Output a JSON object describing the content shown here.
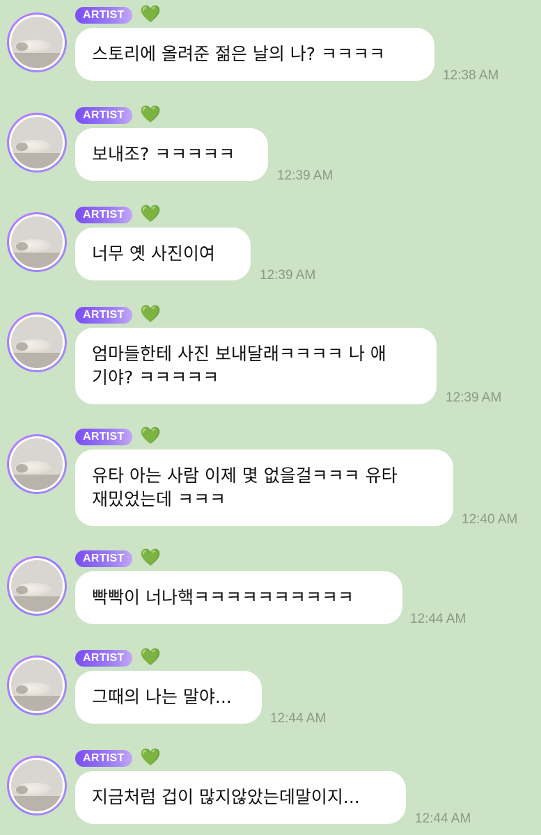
{
  "badge_label": "ARTIST",
  "heart_icon": "💚",
  "messages": [
    {
      "text": "스토리에 올려준 젊은 날의 나? ㅋㅋㅋㅋ",
      "time": "12:38 AM"
    },
    {
      "text": "보내조? ㅋㅋㅋㅋㅋ",
      "time": "12:39 AM"
    },
    {
      "text": "너무 옛 사진이여",
      "time": "12:39 AM"
    },
    {
      "text": "엄마들한테 사진 보내달래ㅋㅋㅋㅋ 나 애\n기야? ㅋㅋㅋㅋㅋ",
      "time": "12:39 AM"
    },
    {
      "text": "유타 아는 사람 이제 몇 없을걸ㅋㅋㅋ 유타\n재밌었는데 ㅋㅋㅋ",
      "time": "12:40 AM"
    },
    {
      "text": "빡빡이 너나핵ㅋㅋㅋㅋㅋㅋㅋㅋㅋㅋ",
      "time": "12:44 AM"
    },
    {
      "text": "그때의 나는 말야...",
      "time": "12:44 AM"
    },
    {
      "text": "지금처럼 겁이 많지않았는데말이지...",
      "time": "12:44 AM"
    }
  ]
}
